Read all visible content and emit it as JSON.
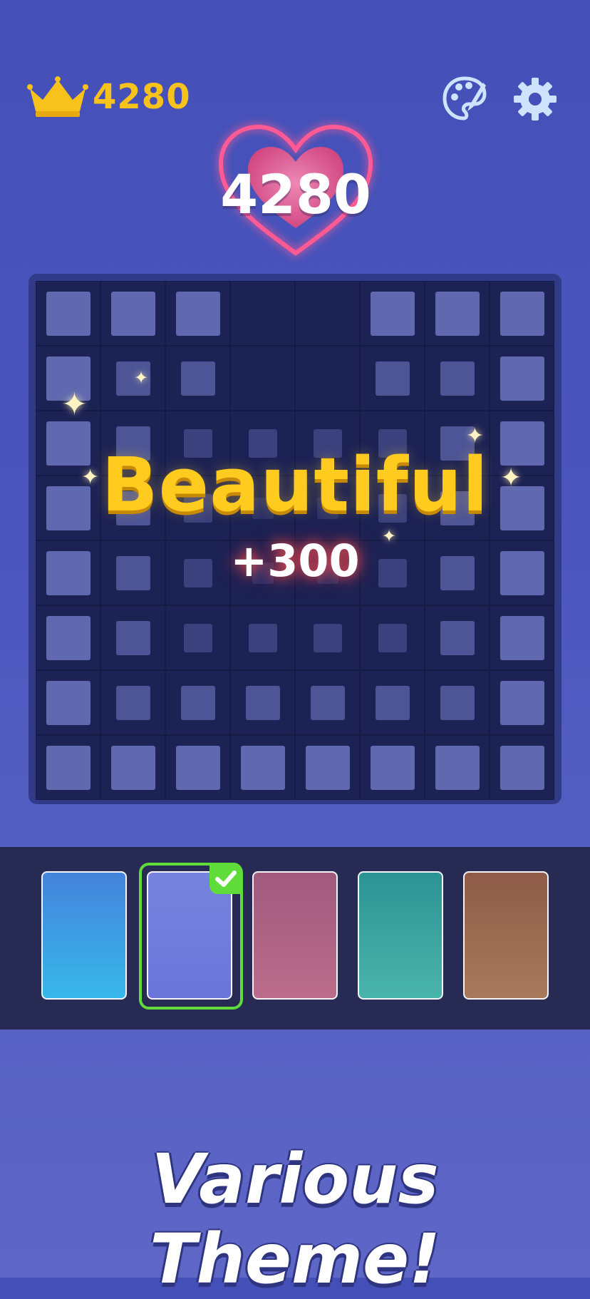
{
  "header": {
    "best_score": "4280",
    "icons": {
      "best": "crown-icon",
      "theme": "palette-icon",
      "settings": "gear-icon"
    }
  },
  "score": {
    "current": "4280",
    "icon": "heart-icon"
  },
  "board": {
    "columns": 8,
    "rows": 8,
    "block_color": "#8a94e6",
    "background": "#1c2254"
  },
  "praise": {
    "text": "Beautiful",
    "bonus": "+300"
  },
  "themes": {
    "selected_index": 1,
    "items": [
      {
        "name": "blue",
        "top": "#4583db",
        "bottom": "#36b8ea"
      },
      {
        "name": "periwinkle",
        "top": "#7783dd",
        "bottom": "#6c75da"
      },
      {
        "name": "rose",
        "top": "#a05a7e",
        "bottom": "#bb6c8a"
      },
      {
        "name": "teal",
        "top": "#2c9393",
        "bottom": "#4ab5ab"
      },
      {
        "name": "brown",
        "top": "#8e5c48",
        "bottom": "#a87a5c"
      }
    ]
  },
  "tagline": "Various Theme!"
}
